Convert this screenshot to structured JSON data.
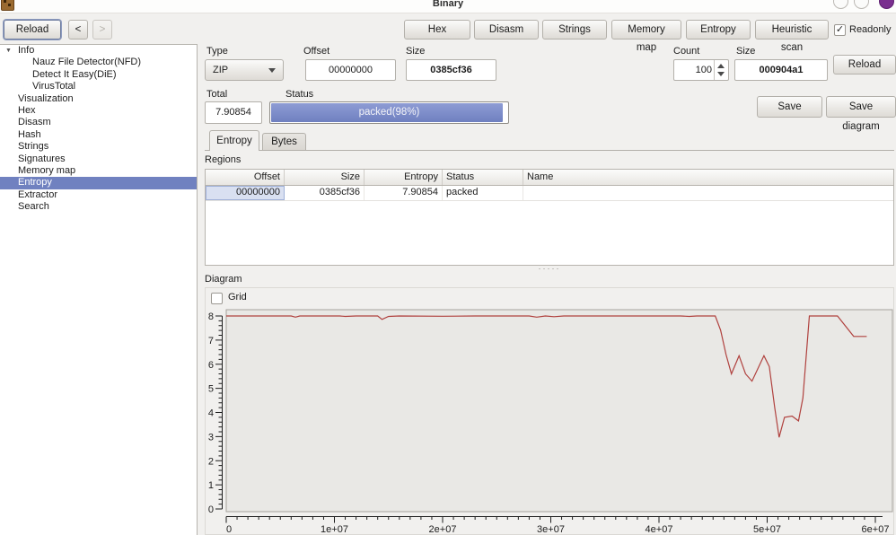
{
  "window": {
    "title": "Binary",
    "controls": [
      "minimize",
      "maximize",
      "badge"
    ]
  },
  "toolbar": {
    "reload_label": "Reload",
    "back_label": "<",
    "forward_label": ">",
    "hex_label": "Hex",
    "disasm_label": "Disasm",
    "strings_label": "Strings",
    "memory_map_label": "Memory map",
    "entropy_label": "Entropy",
    "heuristic_scan_label": "Heuristic scan",
    "readonly_label": "Readonly",
    "readonly_checked": true
  },
  "sidebar": {
    "items": [
      {
        "label": "Info",
        "level": 0,
        "expanded": true
      },
      {
        "label": "Nauz File Detector(NFD)",
        "level": 1
      },
      {
        "label": "Detect It Easy(DiE)",
        "level": 1
      },
      {
        "label": "VirusTotal",
        "level": 1
      },
      {
        "label": "Visualization",
        "level": 0
      },
      {
        "label": "Hex",
        "level": 0
      },
      {
        "label": "Disasm",
        "level": 0
      },
      {
        "label": "Hash",
        "level": 0
      },
      {
        "label": "Strings",
        "level": 0
      },
      {
        "label": "Signatures",
        "level": 0
      },
      {
        "label": "Memory map",
        "level": 0
      },
      {
        "label": "Entropy",
        "level": 0,
        "selected": true
      },
      {
        "label": "Extractor",
        "level": 0
      },
      {
        "label": "Search",
        "level": 0
      }
    ]
  },
  "controls": {
    "type_label": "Type",
    "type_value": "ZIP",
    "offset_label": "Offset",
    "offset_value": "00000000",
    "size_label": "Size",
    "size_value": "0385cf36",
    "count_label": "Count",
    "count_value": "100",
    "size2_label": "Size",
    "size2_value": "000904a1",
    "reload_label": "Reload",
    "total_label": "Total",
    "total_value": "7.90854",
    "status_label": "Status",
    "status_value": "packed(98%)",
    "status_percent": 98,
    "save_label": "Save",
    "save_diagram_label": "Save diagram"
  },
  "tabs": [
    {
      "label": "Entropy",
      "active": true
    },
    {
      "label": "Bytes",
      "active": false
    }
  ],
  "regions": {
    "label": "Regions",
    "columns": [
      "Offset",
      "Size",
      "Entropy",
      "Status",
      "Name"
    ],
    "rows": [
      [
        "00000000",
        "0385cf36",
        "7.90854",
        "packed",
        ""
      ]
    ]
  },
  "diagram": {
    "label": "Diagram",
    "grid_label": "Grid",
    "grid_checked": false
  },
  "colors": {
    "selection_blue": "#7081c0",
    "progress_blue": "#6f80c0",
    "chart_line_red": "#b0413e",
    "chart_plot_bg": "#e9e8e5",
    "window_bg": "#f1f0ee"
  },
  "chart_data": {
    "type": "line",
    "title": "",
    "xlabel": "",
    "ylabel": "",
    "xlim": [
      0,
      60000000
    ],
    "ylim": [
      0,
      8
    ],
    "x_ticks": [
      "0",
      "1e+07",
      "2e+07",
      "3e+07",
      "4e+07",
      "5e+07",
      "6e+07"
    ],
    "y_ticks": [
      "0",
      "1",
      "2",
      "3",
      "4",
      "5",
      "6",
      "7",
      "8"
    ],
    "grid": false,
    "legend": "none",
    "series": [
      {
        "name": "entropy",
        "color": "#b0413e",
        "points": [
          [
            0,
            8.0
          ],
          [
            4000000,
            8.0
          ],
          [
            6000000,
            8.0
          ],
          [
            6400000,
            7.95
          ],
          [
            6800000,
            8.0
          ],
          [
            10500000,
            8.0
          ],
          [
            11000000,
            7.98
          ],
          [
            12000000,
            8.0
          ],
          [
            14000000,
            8.0
          ],
          [
            14400000,
            7.86
          ],
          [
            15000000,
            7.98
          ],
          [
            16000000,
            8.0
          ],
          [
            20000000,
            7.99
          ],
          [
            23000000,
            8.0
          ],
          [
            28000000,
            8.0
          ],
          [
            28700000,
            7.95
          ],
          [
            29500000,
            8.0
          ],
          [
            30300000,
            7.97
          ],
          [
            31200000,
            8.0
          ],
          [
            35000000,
            8.0
          ],
          [
            42000000,
            8.0
          ],
          [
            42800000,
            7.98
          ],
          [
            43500000,
            8.0
          ],
          [
            45200000,
            8.0
          ],
          [
            45700000,
            7.4
          ],
          [
            46200000,
            6.4
          ],
          [
            46700000,
            5.6
          ],
          [
            47400000,
            6.35
          ],
          [
            48000000,
            5.6
          ],
          [
            48600000,
            5.3
          ],
          [
            49700000,
            6.35
          ],
          [
            50200000,
            5.9
          ],
          [
            50700000,
            4.2
          ],
          [
            51100000,
            2.97
          ],
          [
            51600000,
            3.8
          ],
          [
            52300000,
            3.85
          ],
          [
            52900000,
            3.65
          ],
          [
            53300000,
            4.6
          ],
          [
            53900000,
            8.0
          ],
          [
            56500000,
            8.0
          ],
          [
            58000000,
            7.15
          ],
          [
            59200000,
            7.15
          ]
        ]
      }
    ]
  }
}
